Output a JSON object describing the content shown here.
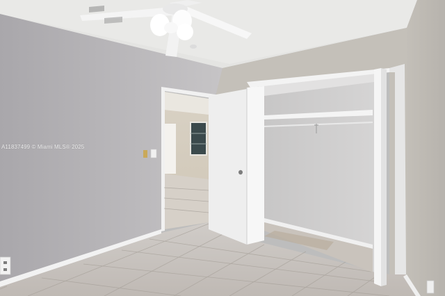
{
  "photo": {
    "watermark": "A11837499 © Miami MLS® 2025"
  },
  "colors": {
    "wall": "#b7b5b7",
    "ceiling": "#e6e6e4",
    "floor": "#c7c2bd",
    "trim": "#f2f2f2",
    "door": "#efefef",
    "closet_interior": "#cfcfcf"
  }
}
